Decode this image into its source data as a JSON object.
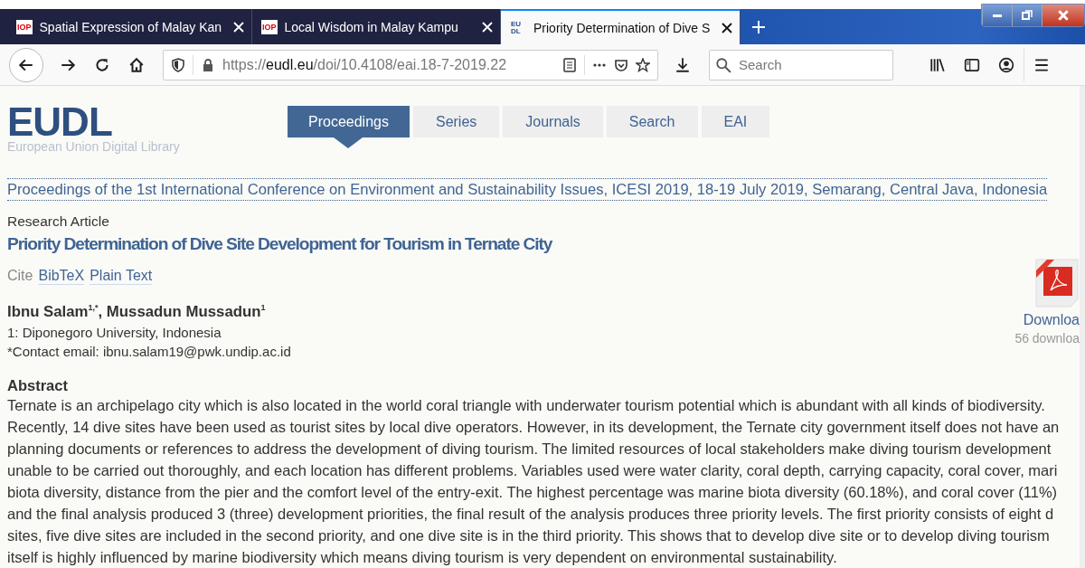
{
  "browser": {
    "tabs": [
      {
        "favicon": "IOP",
        "title": "Spatial Expression of Malay Kan",
        "selected": false
      },
      {
        "favicon": "IOP",
        "title": "Local Wisdom in Malay Kampu",
        "selected": false
      },
      {
        "favicon": "EUDL",
        "title": "Priority Determination of Dive S",
        "selected": true
      }
    ],
    "url_scheme": "https://",
    "url_domain": "eudl.eu",
    "url_path": "/doi/10.4108/eai.18-7-2019.22",
    "search_placeholder": "Search"
  },
  "site": {
    "logo": "EUDL",
    "logo_subtitle": "European Union Digital Library",
    "nav": [
      {
        "label": "Proceedings",
        "selected": true
      },
      {
        "label": "Series",
        "selected": false
      },
      {
        "label": "Journals",
        "selected": false
      },
      {
        "label": "Search",
        "selected": false
      },
      {
        "label": "EAI",
        "selected": false
      }
    ]
  },
  "article": {
    "proceedings_link": "Proceedings of the 1st International Conference on Environment and Sustainability Issues, ICESI 2019, 18-19 July 2019, Semarang, Central Java, Indonesia",
    "type": "Research Article",
    "title": "Priority Determination of Dive Site Development for Tourism in Ternate City",
    "cite_label": "Cite",
    "cite_links": [
      "BibTeX",
      "Plain Text"
    ],
    "authors": "Ibnu Salam$^{1,*}$, Mussadun Mussadun$^{1}$",
    "affiliation": "1: Diponegoro University, Indonesia",
    "contact": "*Contact email: ibnu.salam19@pwk.undip.ac.id",
    "download_label": "Downloa",
    "download_count": "56 downloa",
    "abstract_heading": "Abstract",
    "abstract_lines": [
      "Ternate is an archipelago city which is also located in the world coral triangle with underwater tourism potential which is abundant with all kinds of biodiversity.",
      "Recently, 14 dive sites have been used as tourist sites by local dive operators. However, in its development, the Ternate city government itself does not have an",
      "planning documents or references to address the development of diving tourism. The limited resources of local stakeholders make diving tourism development",
      "unable to be carried out thoroughly, and each location has different problems. Variables used were water clarity, coral depth, carrying capacity, coral cover, mari",
      "biota diversity, distance from the pier and the comfort level of the entry-exit. The highest percentage was marine biota diversity (60.18%), and coral cover (11%)",
      "and the final analysis produced 3 (three) development priorities, the final result of the analysis produces three priority levels. The first priority consists of eight d",
      "sites, five dive sites are included in the second priority, and one dive site is in the third priority. This shows that to develop dive site or to develop diving tourism",
      "itself is highly influenced by marine biodiversity which means diving tourism is very dependent on environmental sustainability."
    ]
  }
}
